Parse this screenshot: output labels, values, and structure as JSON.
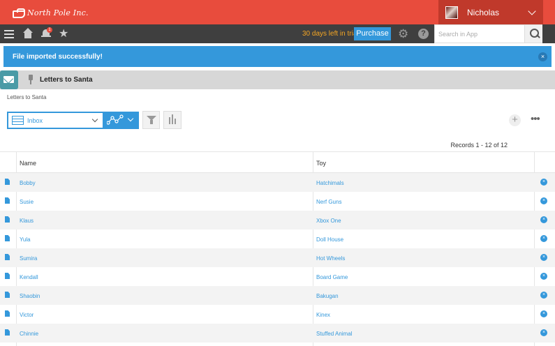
{
  "header": {
    "logo_text": "North Pole Inc.",
    "user_name": "Nicholas"
  },
  "toolbar": {
    "notification_count": "1",
    "trial_text": "30 days left in trial",
    "purchase_label": "Purchase",
    "help_label": "?",
    "search_placeholder": "Search in App"
  },
  "notice": {
    "message": "File imported successfully!",
    "close_label": "×"
  },
  "app": {
    "title": "Letters to Santa",
    "breadcrumb": "Letters to Santa"
  },
  "view": {
    "selected": "Inbox",
    "add_label": "+",
    "more_label": "•••"
  },
  "records_text": "Records 1 - 12 of 12",
  "table": {
    "columns": [
      "Name",
      "Toy"
    ],
    "rows": [
      {
        "name": "Bobby",
        "toy": "Hatchimals"
      },
      {
        "name": "Susie",
        "toy": "Nerf Guns"
      },
      {
        "name": "Klaus",
        "toy": "Xbox One"
      },
      {
        "name": "Yula",
        "toy": "Doll House"
      },
      {
        "name": "Sumira",
        "toy": "Hot Wheels"
      },
      {
        "name": "Kendall",
        "toy": "Board Game"
      },
      {
        "name": "Shaobin",
        "toy": "Bakugan"
      },
      {
        "name": "Victor",
        "toy": "Kinex"
      },
      {
        "name": "Chinnie",
        "toy": "Stuffed Animal"
      }
    ],
    "delete_label": "×"
  },
  "colors": {
    "brand_red": "#e84c3d",
    "accent_blue": "#3498db",
    "toolbar_dark": "#3f3f3f",
    "trial_orange": "#f5a623"
  }
}
